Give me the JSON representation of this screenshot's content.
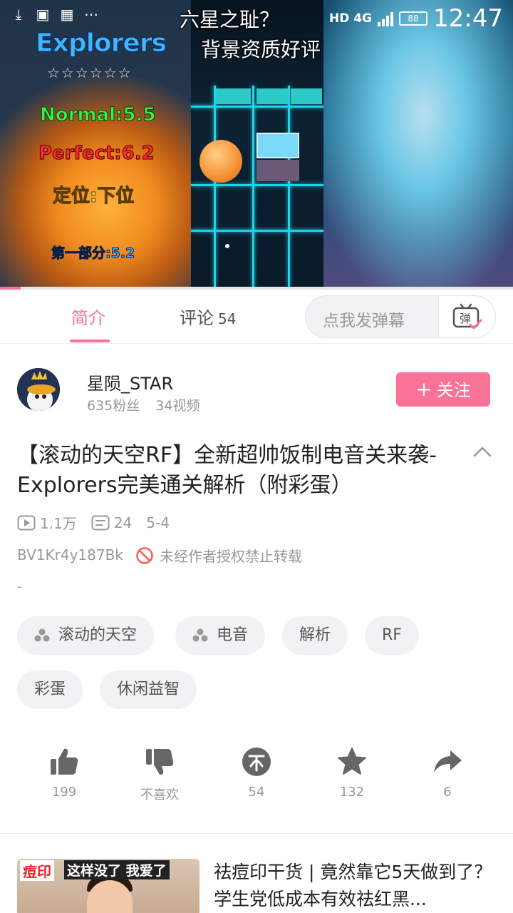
{
  "status_bar": {
    "network": "HD 4G",
    "battery": "88",
    "time": "12:47"
  },
  "video": {
    "overlay_title": "Explorers",
    "overlay_stars": "☆☆☆☆☆☆",
    "overlay_normal": "Normal:5.5",
    "overlay_perfect": "Perfect:6.2",
    "overlay_position": "定位:下位",
    "overlay_part": "第一部分:5.2",
    "danmaku_1": "六星之耻？",
    "danmaku_2": "背景资质好评",
    "progress": 0.04
  },
  "tabs": {
    "intro_label": "简介",
    "comments_label": "评论",
    "comments_count": "54",
    "danmaku_placeholder": "点我发弹幕",
    "danmaku_button_label": "弹"
  },
  "author": {
    "name": "星陨_STAR",
    "fans": "635粉丝",
    "videos": "34视频",
    "follow_label": "关注"
  },
  "video_info": {
    "title": "【滚动的天空RF】全新超帅饭制电音关来袭-Explorers完美通关解析（附彩蛋）",
    "views": "1.1万",
    "danmaku_count": "24",
    "date": "5-4",
    "bvid": "BV1Kr4y187Bk",
    "copyright": "未经作者授权禁止转载",
    "description": "-"
  },
  "tags": [
    "滚动的天空",
    "电音",
    "解析",
    "RF",
    "彩蛋",
    "休闲益智"
  ],
  "actions": {
    "like_count": "199",
    "dislike_label": "不喜欢",
    "coin_count": "54",
    "favorite_count": "132",
    "share_count": "6"
  },
  "recommendation": {
    "thumb_badge_1": "痘印",
    "thumb_badge_2": "这样没了 我爱了",
    "title": "祛痘印干货 | 竟然靠它5天做到了？ 学生党低成本有效祛红黑..."
  },
  "colors": {
    "accent": "#fb7299",
    "muted": "#999999"
  }
}
